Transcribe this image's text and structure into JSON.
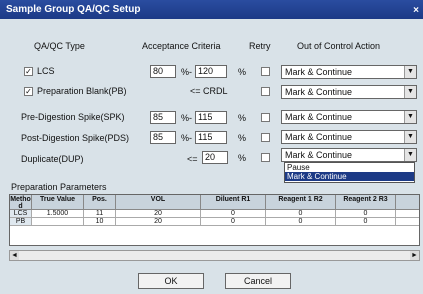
{
  "window": {
    "title": "Sample Group QA/QC Setup",
    "close": "×"
  },
  "headers": {
    "type": "QA/QC Type",
    "criteria": "Acceptance Criteria",
    "retry": "Retry",
    "action": "Out of Control Action"
  },
  "rows": [
    {
      "label": "LCS",
      "checked": true,
      "check_mark": "✓",
      "low": "80",
      "sep": "%-",
      "high": "120",
      "unit": "%",
      "action": "Mark & Continue"
    },
    {
      "label": "Preparation Blank(PB)",
      "checked": true,
      "check_mark": "✓",
      "crdl": "<= CRDL",
      "action": "Mark & Continue"
    },
    {
      "label": "Pre-Digestion Spike(SPK)",
      "checked": false,
      "low": "85",
      "sep": "%-",
      "high": "115",
      "unit": "%",
      "action": "Mark & Continue"
    },
    {
      "label": "Post-Digestion Spike(PDS)",
      "checked": false,
      "low": "85",
      "sep": "%-",
      "high": "115",
      "unit": "%",
      "action": "Mark & Continue"
    },
    {
      "label": "Duplicate(DUP)",
      "checked": false,
      "le": "<=",
      "value": "20",
      "unit": "%",
      "action": "Mark & Continue"
    }
  ],
  "dropdown_options": [
    "Pause",
    "Mark & Continue"
  ],
  "prep": {
    "title": "Preparation Parameters",
    "columns": [
      "Metho d",
      "True Value",
      "Pos.",
      "VOL",
      "Diluent R1",
      "Reagent 1 R2",
      "Reagent 2 R3",
      ""
    ],
    "rows": [
      [
        "LCS",
        "1.5000",
        "11",
        "20",
        "0",
        "0",
        "0",
        ""
      ],
      [
        "PB",
        "",
        "10",
        "20",
        "0",
        "0",
        "0",
        ""
      ]
    ]
  },
  "scroll": {
    "left": "◄",
    "right": "►"
  },
  "buttons": {
    "ok": "OK",
    "cancel": "Cancel"
  },
  "icons": {
    "arrow": "▼"
  }
}
